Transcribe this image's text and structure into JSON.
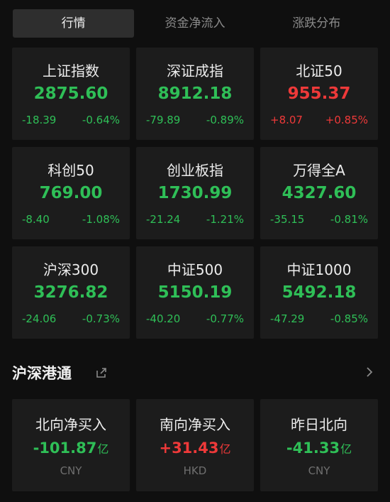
{
  "tabs": [
    "行情",
    "资金净流入",
    "涨跌分布"
  ],
  "indices": [
    {
      "name": "上证指数",
      "value": "2875.60",
      "change": "-18.39",
      "pct": "-0.64%",
      "dir": "down"
    },
    {
      "name": "深证成指",
      "value": "8912.18",
      "change": "-79.89",
      "pct": "-0.89%",
      "dir": "down"
    },
    {
      "name": "北证50",
      "value": "955.37",
      "change": "+8.07",
      "pct": "+0.85%",
      "dir": "up"
    },
    {
      "name": "科创50",
      "value": "769.00",
      "change": "-8.40",
      "pct": "-1.08%",
      "dir": "down"
    },
    {
      "name": "创业板指",
      "value": "1730.99",
      "change": "-21.24",
      "pct": "-1.21%",
      "dir": "down"
    },
    {
      "name": "万得全A",
      "value": "4327.60",
      "change": "-35.15",
      "pct": "-0.81%",
      "dir": "down"
    },
    {
      "name": "沪深300",
      "value": "3276.82",
      "change": "-24.06",
      "pct": "-0.73%",
      "dir": "down"
    },
    {
      "name": "中证500",
      "value": "5150.19",
      "change": "-40.20",
      "pct": "-0.77%",
      "dir": "down"
    },
    {
      "name": "中证1000",
      "value": "5492.18",
      "change": "-47.29",
      "pct": "-0.85%",
      "dir": "down"
    }
  ],
  "section": {
    "title": "沪深港通",
    "share_icon": "share-icon",
    "more_icon": "chevron-right-icon"
  },
  "flows": [
    {
      "name": "北向净买入",
      "value": "-101.87",
      "unit": "亿",
      "currency": "CNY",
      "dir": "down"
    },
    {
      "name": "南向净买入",
      "value": "+31.43",
      "unit": "亿",
      "currency": "HKD",
      "dir": "up"
    },
    {
      "name": "昨日北向",
      "value": "-41.33",
      "unit": "亿",
      "currency": "CNY",
      "dir": "down"
    }
  ],
  "colors": {
    "down": "#2fbf57",
    "up": "#ee3939",
    "card": "#1c1c1c",
    "background": "#0f0f0f"
  }
}
